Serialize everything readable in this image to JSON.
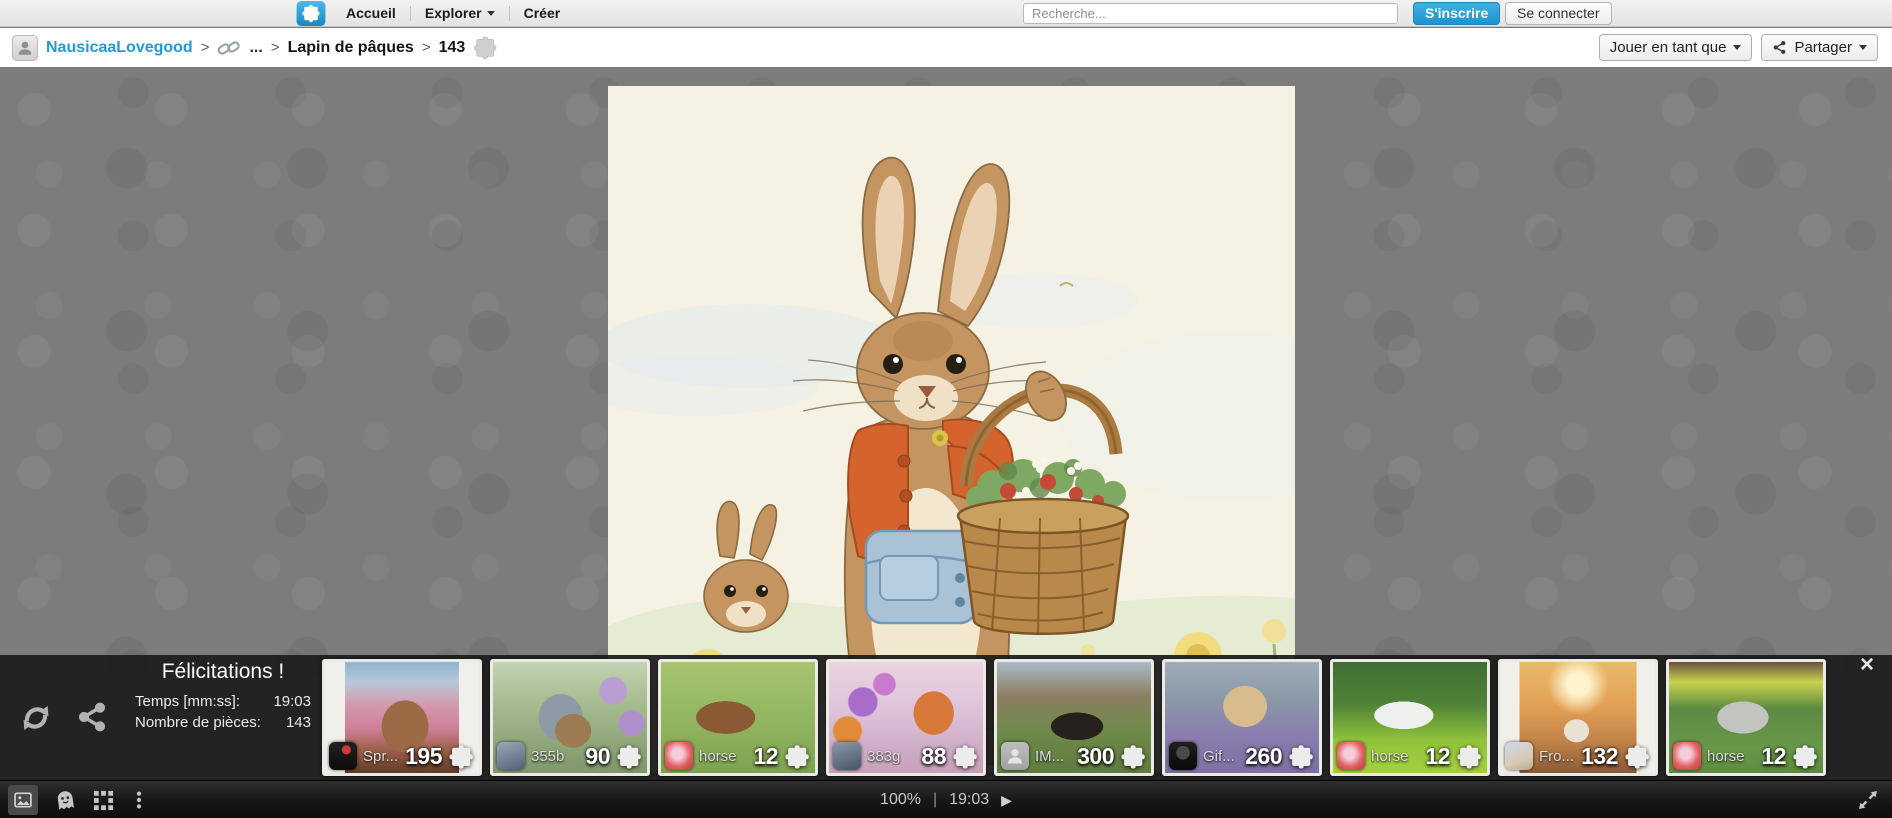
{
  "topnav": {
    "home_label": "Accueil",
    "explore_label": "Explorer",
    "create_label": "Créer",
    "search_placeholder": "Recherche...",
    "signup_label": "S'inscrire",
    "login_label": "Se connecter"
  },
  "breadcrumb": {
    "username": "NausicaaLovegood",
    "separator": ">",
    "ellipsis_label": "...",
    "album_label": "Lapin de pâques",
    "puzzle_label": "143",
    "play_as_label": "Jouer en tant que",
    "share_label": "Partager"
  },
  "congrats": {
    "title": "Félicitations !",
    "time_label": "Temps [mm:ss]:",
    "time_value": "19:03",
    "pieces_label": "Nombre de pièces:",
    "pieces_value": "143"
  },
  "tiles": [
    {
      "name": "Spr...",
      "pieces": "195"
    },
    {
      "name": "355b",
      "pieces": "90"
    },
    {
      "name": "horse",
      "pieces": "12"
    },
    {
      "name": "383g",
      "pieces": "88"
    },
    {
      "name": "IM...",
      "pieces": "300"
    },
    {
      "name": "Gif...",
      "pieces": "260"
    },
    {
      "name": "horse",
      "pieces": "12"
    },
    {
      "name": "Fro...",
      "pieces": "132"
    },
    {
      "name": "horse",
      "pieces": "12"
    }
  ],
  "overlay": {
    "close_label": "×"
  },
  "statusbar": {
    "zoom_level": "100%",
    "divider": "|",
    "time": "19:03",
    "play_icon": "▶"
  },
  "colors": {
    "accent_blue": "#2aa4de",
    "link_blue": "#1f9cd8",
    "overlay_bg": "#1c1c1c",
    "main_bg": "#7c7c7c",
    "topbar_bg": "#ededed"
  }
}
